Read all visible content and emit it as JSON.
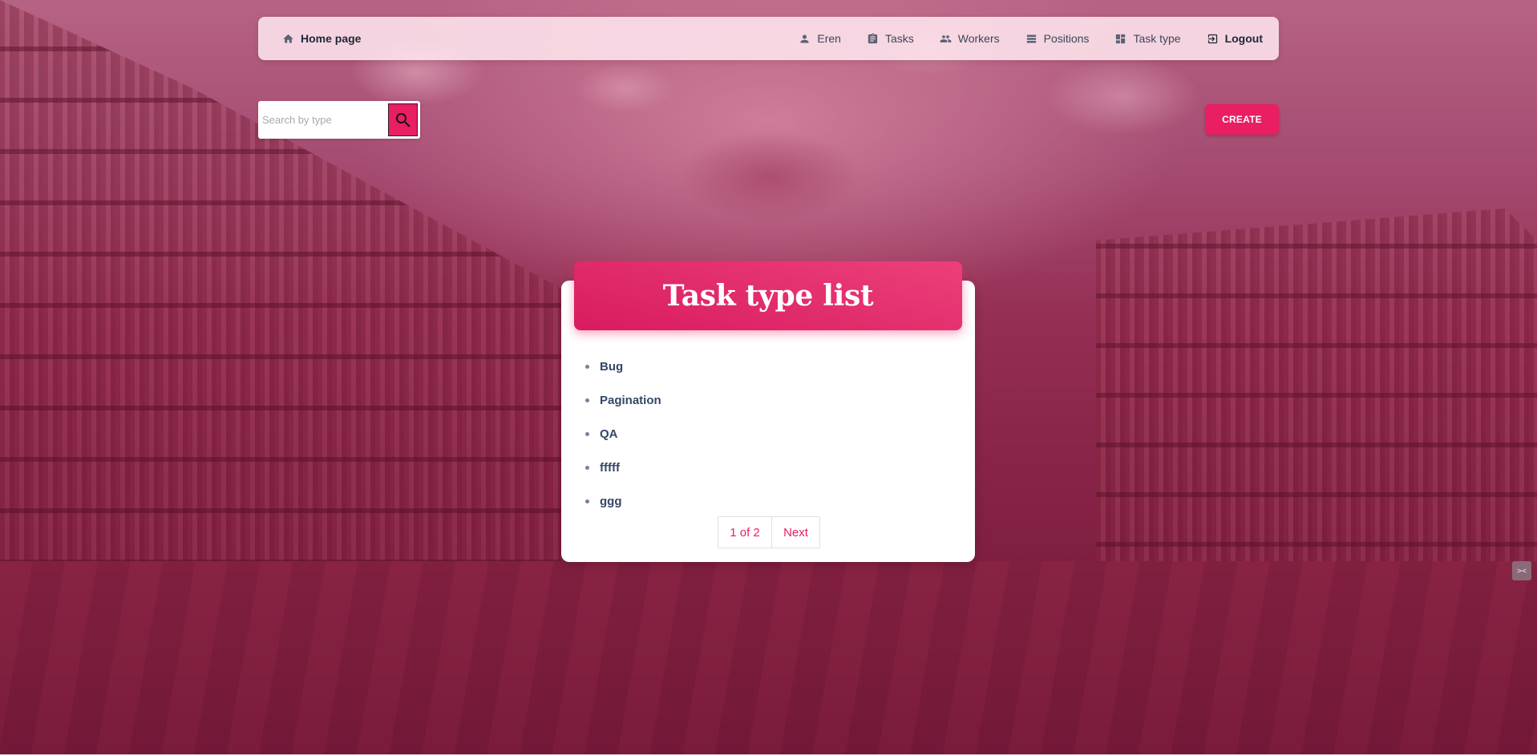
{
  "navbar": {
    "home_label": "Home page",
    "user_label": "Eren",
    "tasks_label": "Tasks",
    "workers_label": "Workers",
    "positions_label": "Positions",
    "task_type_label": "Task type",
    "logout_label": "Logout"
  },
  "search": {
    "placeholder": "Search by type",
    "value": ""
  },
  "actions": {
    "create_label": "CREATE"
  },
  "card": {
    "title": "Task type list",
    "items": [
      {
        "label": "Bug"
      },
      {
        "label": "Pagination"
      },
      {
        "label": "QA"
      },
      {
        "label": "fffff"
      },
      {
        "label": "ggg"
      }
    ]
  },
  "pagination": {
    "info": "1 of 2",
    "next_label": "Next"
  },
  "colors": {
    "accent": "#e91e63",
    "text_dark": "#344767"
  }
}
